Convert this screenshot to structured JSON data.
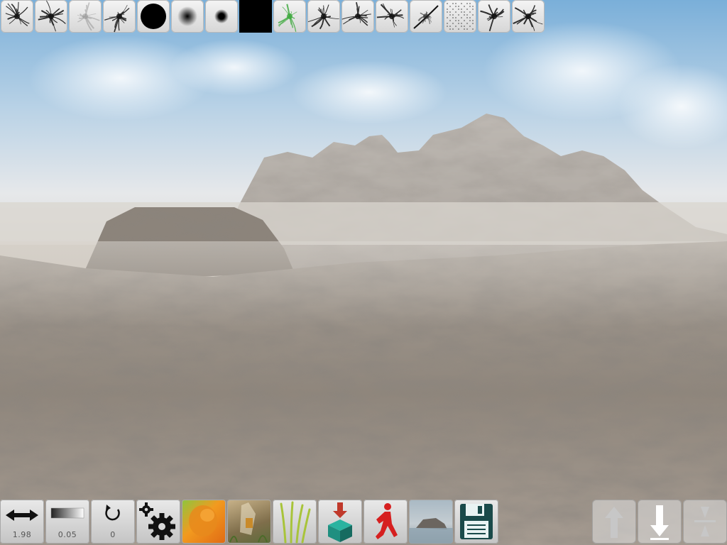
{
  "brushes": [
    {
      "icon": "splatter-brush-icon"
    },
    {
      "icon": "splatter-brush-icon"
    },
    {
      "icon": "faint-splatter-brush-icon"
    },
    {
      "icon": "splatter-brush-icon"
    },
    {
      "icon": "hard-round-brush-icon"
    },
    {
      "icon": "soft-round-brush-icon"
    },
    {
      "icon": "small-round-brush-icon"
    },
    {
      "icon": "solid-square-brush-icon"
    },
    {
      "icon": "green-splatter-brush-icon"
    },
    {
      "icon": "splatter-brush-icon"
    },
    {
      "icon": "splatter-brush-icon"
    },
    {
      "icon": "splatter-brush-icon"
    },
    {
      "icon": "streak-brush-icon"
    },
    {
      "icon": "noise-brush-icon"
    },
    {
      "icon": "splatter-brush-icon"
    },
    {
      "icon": "splatter-brush-icon"
    }
  ],
  "toolbar": {
    "size_value": "1.98",
    "opacity_value": "0.05",
    "rotation_value": "0"
  },
  "colors": {
    "sky_top": "#7fb3db",
    "sky_bottom": "#e9ecef",
    "fog": "#d8d3cc",
    "rock": "#9a928a",
    "settings_gear": "#111111",
    "texture_orange": "#e8891c",
    "texture_green": "#6fb03a",
    "grass": "#a8c43a",
    "spawn_arrow": "#c0392b",
    "cube_teal": "#1f8f80",
    "walker_red": "#d61f1f",
    "save_disk": "#1a4a4a"
  }
}
